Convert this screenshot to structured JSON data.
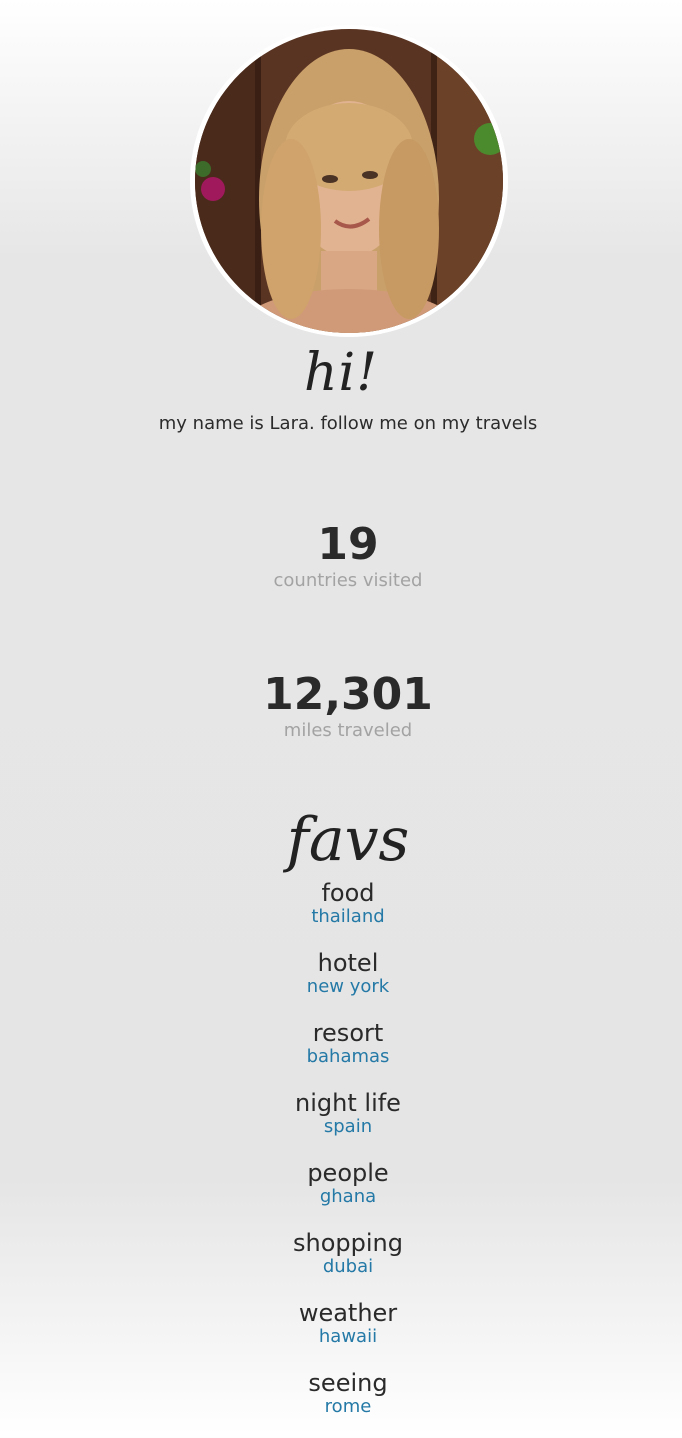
{
  "profile": {
    "greeting": "hi!",
    "intro": "my name is Lara. follow me on my travels"
  },
  "stats": [
    {
      "value": "19",
      "label": "countries visited"
    },
    {
      "value": "12,301",
      "label": "miles traveled"
    }
  ],
  "favs": {
    "title": "favs",
    "items": [
      {
        "category": "food",
        "place": "thailand"
      },
      {
        "category": "hotel",
        "place": "new york"
      },
      {
        "category": "resort",
        "place": "bahamas"
      },
      {
        "category": "night life",
        "place": "spain"
      },
      {
        "category": "people",
        "place": "ghana"
      },
      {
        "category": "shopping",
        "place": "dubai"
      },
      {
        "category": "weather",
        "place": "hawaii"
      },
      {
        "category": "seeing",
        "place": "rome"
      }
    ]
  },
  "colors": {
    "text": "#2b2b2b",
    "muted": "#a3a3a3",
    "accent": "#2479a6",
    "background": "#e5e5e5"
  }
}
